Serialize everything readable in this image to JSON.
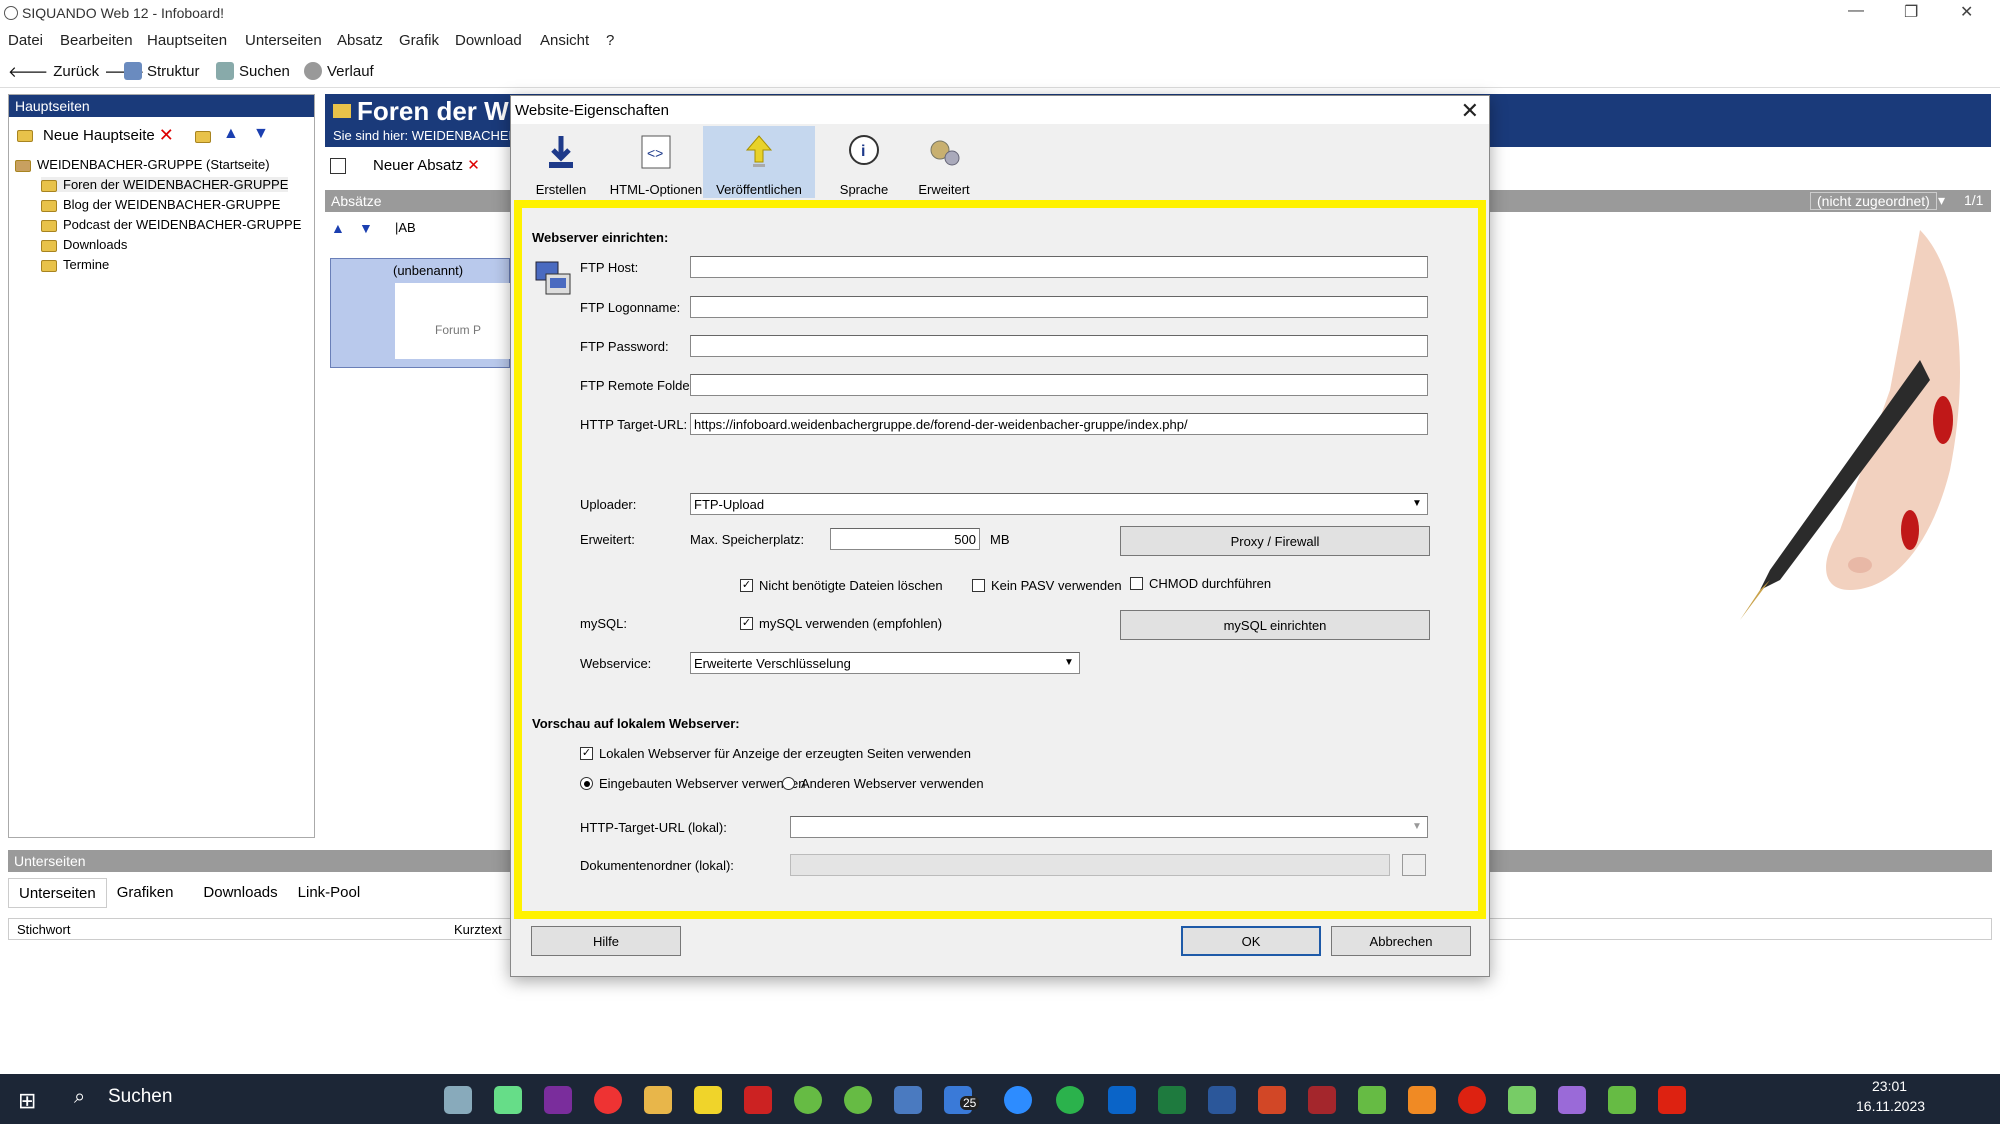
{
  "app": {
    "title": "SIQUANDO Web 12 - Infoboard!"
  },
  "menu": [
    "Datei",
    "Bearbeiten",
    "Hauptseiten",
    "Unterseiten",
    "Absatz",
    "Grafik",
    "Download",
    "Ansicht",
    "?"
  ],
  "toolbar": {
    "back": "Zurück",
    "struktur": "Struktur",
    "suchen": "Suchen",
    "verlauf": "Verlauf"
  },
  "left": {
    "header": "Hauptseiten",
    "new_label": "Neue Hauptseite",
    "tree": [
      "WEIDENBACHER-GRUPPE (Startseite)",
      "Foren der WEIDENBACHER-GRUPPE",
      "Blog der WEIDENBACHER-GRUPPE",
      "Podcast der WEIDENBACHER-GRUPPE",
      "Downloads",
      "Termine"
    ]
  },
  "main": {
    "title": "Foren der W",
    "breadcrumb": "Sie sind hier: WEIDENBACHER",
    "new_absatz": "Neuer Absatz",
    "absaetze": "Absätze",
    "unnamed": "(unbenannt)",
    "forum_caption": "Forum P",
    "unassigned": "(nicht zugeordnet)",
    "page_count": "1/1"
  },
  "bottom": {
    "header": "Unterseiten",
    "tabs": [
      "Unterseiten",
      "Grafiken",
      "Downloads",
      "Link-Pool"
    ],
    "col_stichwort": "Stichwort",
    "col_kurztext": "Kurztext"
  },
  "dialog": {
    "title": "Website-Eigenschaften",
    "tabs": [
      "Erstellen",
      "HTML-Optionen",
      "Veröffentlichen",
      "Sprache",
      "Erweitert"
    ],
    "section1": "Webserver einrichten:",
    "ftp_host_label": "FTP Host:",
    "ftp_host": "",
    "ftp_logon_label": "FTP Logonname:",
    "ftp_logon": "",
    "ftp_pass_label": "FTP Password:",
    "ftp_pass": "",
    "ftp_folder_label": "FTP Remote Folder:",
    "ftp_folder": "",
    "http_label": "HTTP Target-URL:",
    "http_url": "https://infoboard.weidenbachergruppe.de/forend-der-weidenbacher-gruppe/index.php/",
    "uploader_label": "Uploader:",
    "uploader": "FTP-Upload",
    "erweitert_label": "Erweitert:",
    "max_label": "Max. Speicherplatz:",
    "max_value": "500",
    "mb": "MB",
    "proxy_btn": "Proxy / Firewall",
    "chk_delete": "Nicht benötigte Dateien löschen",
    "chk_pasv": "Kein PASV verwenden",
    "chk_chmod": "CHMOD durchführen",
    "mysql_label": "mySQL:",
    "chk_mysql": "mySQL verwenden (empfohlen)",
    "mysql_btn": "mySQL einrichten",
    "webservice_label": "Webservice:",
    "webservice": "Erweiterte Verschlüsselung",
    "section2": "Vorschau auf lokalem Webserver:",
    "chk_local": "Lokalen Webserver für Anzeige der erzeugten Seiten verwenden",
    "radio_builtin": "Eingebauten Webserver verwenden",
    "radio_other": "Anderen Webserver verwenden",
    "http_local_label": "HTTP-Target-URL (lokal):",
    "docs_label": "Dokumentenordner (lokal):",
    "help_btn": "Hilfe",
    "ok_btn": "OK",
    "cancel_btn": "Abbrechen"
  },
  "taskbar": {
    "search": "Suchen",
    "time": "23:01",
    "date": "16.11.2023",
    "badge": "25"
  },
  "colors": {
    "highlight": "#fff200",
    "navy": "#1a3a7a"
  }
}
